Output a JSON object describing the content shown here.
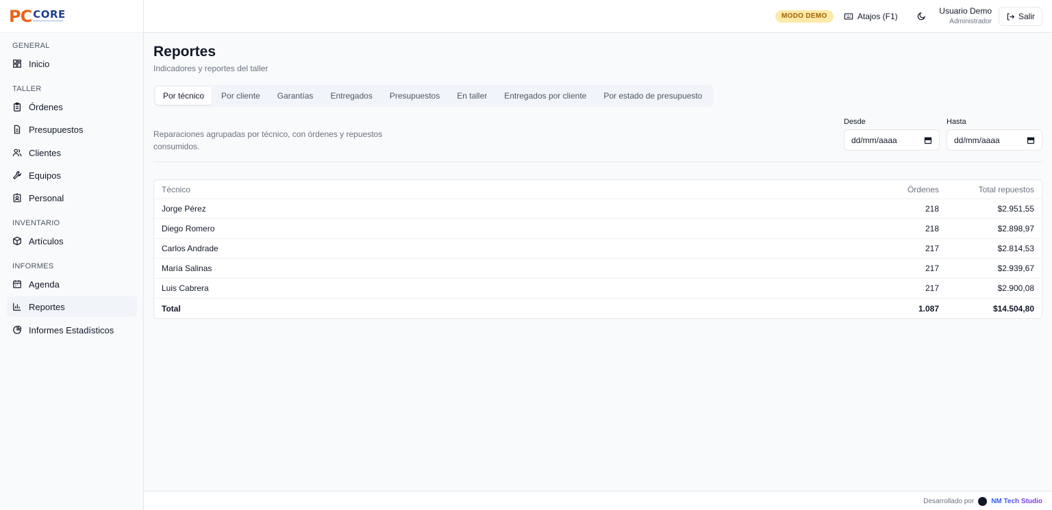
{
  "brand": {
    "logo_pc": "PC",
    "logo_core": "CORE"
  },
  "sidebar": {
    "sections": [
      {
        "title": "GENERAL",
        "items": [
          {
            "label": "Inicio",
            "icon": "grid-icon"
          }
        ]
      },
      {
        "title": "TALLER",
        "items": [
          {
            "label": "Órdenes",
            "icon": "clipboard-icon"
          },
          {
            "label": "Presupuestos",
            "icon": "document-icon"
          },
          {
            "label": "Clientes",
            "icon": "users-icon"
          },
          {
            "label": "Equipos",
            "icon": "wrench-icon"
          },
          {
            "label": "Personal",
            "icon": "id-badge-icon"
          }
        ]
      },
      {
        "title": "INVENTARIO",
        "items": [
          {
            "label": "Artículos",
            "icon": "box-icon"
          }
        ]
      },
      {
        "title": "INFORMES",
        "items": [
          {
            "label": "Agenda",
            "icon": "calendar-icon"
          },
          {
            "label": "Reportes",
            "icon": "bar-chart-icon",
            "active": true
          },
          {
            "label": "Informes Estadísticos",
            "icon": "pie-chart-icon"
          }
        ]
      }
    ]
  },
  "header": {
    "demo_badge": "MODO DEMO",
    "shortcuts_label": "Atajos (F1)",
    "user_name": "Usuario Demo",
    "user_role": "Administrador",
    "logout_label": "Salir"
  },
  "page": {
    "title": "Reportes",
    "subtitle": "Indicadores y reportes del taller",
    "tabs": [
      "Por técnico",
      "Por cliente",
      "Garantías",
      "Entregados",
      "Presupuestos",
      "En taller",
      "Entregados por cliente",
      "Por estado de presupuesto"
    ],
    "active_tab": "Por técnico",
    "description": "Reparaciones agrupadas por técnico, con órdenes y repuestos consumidos.",
    "filters": {
      "from_label": "Desde",
      "from_placeholder": "dd/mm/aaaa",
      "to_label": "Hasta",
      "to_placeholder": "dd/mm/aaaa"
    }
  },
  "table": {
    "headers": {
      "tech": "Técnico",
      "orders": "Órdenes",
      "total": "Total repuestos"
    },
    "rows": [
      {
        "tech": "Jorge Pérez",
        "orders": "218",
        "total": "$2.951,55"
      },
      {
        "tech": "Diego Romero",
        "orders": "218",
        "total": "$2.898,97"
      },
      {
        "tech": "Carlos Andrade",
        "orders": "217",
        "total": "$2.814,53"
      },
      {
        "tech": "María Salinas",
        "orders": "217",
        "total": "$2.939,67"
      },
      {
        "tech": "Luis Cabrera",
        "orders": "217",
        "total": "$2.900,08"
      }
    ],
    "total_row": {
      "tech": "Total",
      "orders": "1.087",
      "total": "$14.504,80"
    }
  },
  "footer": {
    "developed_by": "Desarrollado por",
    "brand": "NM Tech Studio"
  },
  "colors": {
    "accent_orange": "#e8641c",
    "accent_blue": "#1f3f8f",
    "demo_badge_bg": "#fde9a8"
  }
}
